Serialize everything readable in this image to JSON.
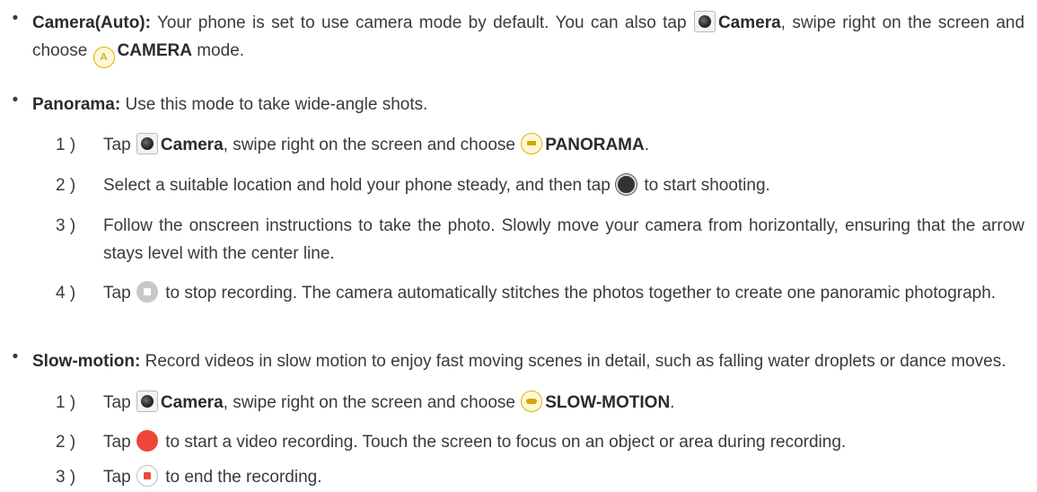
{
  "camera_auto": {
    "bullet": "•",
    "title": "Camera(Auto):",
    "text1": "Your phone is set to use camera mode by default. You can also tap",
    "camera_label": "Camera",
    "text2": ", swipe right on the screen and choose",
    "mode_icon_letter": "A",
    "mode_label": "CAMERA",
    "text3": "mode."
  },
  "panorama": {
    "bullet": "•",
    "title": "Panorama:",
    "text": "Use this mode to take wide-angle shots.",
    "steps": [
      {
        "num": "1 )",
        "a": "Tap",
        "camera_label": "Camera",
        "b": ", swipe right on the screen and choose",
        "mode_label": "PANORAMA",
        "c": "."
      },
      {
        "num": "2 )",
        "a": "Select a suitable location and hold your phone steady, and then tap",
        "b": "to start shooting."
      },
      {
        "num": "3 )",
        "text": "Follow the onscreen instructions to take the photo. Slowly move your camera from horizontally, ensuring that the arrow stays level with the center line."
      },
      {
        "num": "4 )",
        "a": "Tap",
        "b": "to stop recording. The camera automatically stitches the photos together to create one panoramic photograph."
      }
    ]
  },
  "slow_motion": {
    "bullet": "•",
    "title": "Slow-motion:",
    "text": "Record videos in slow motion to enjoy fast moving scenes in detail, such as falling water droplets or dance moves.",
    "steps": [
      {
        "num": "1 )",
        "a": "Tap",
        "camera_label": "Camera",
        "b": ", swipe right on the screen and choose",
        "mode_label": "SLOW-MOTION",
        "c": "."
      },
      {
        "num": "2 )",
        "a": "Tap",
        "b": "to start a video recording. Touch the screen to focus on an object or area during recording."
      },
      {
        "num": "3 )",
        "a": "Tap",
        "b": "to end the recording."
      }
    ]
  },
  "icons": {
    "camera_app": "camera-app-icon",
    "camera_mode": "auto-mode-icon",
    "panorama_mode": "panorama-mode-icon",
    "slow_motion_mode": "slow-motion-mode-icon",
    "shutter": "shutter-button-icon",
    "stop_gray": "stop-button-icon",
    "record_red": "record-button-icon",
    "stop_red": "stop-recording-icon"
  },
  "colors": {
    "text": "#3a3a3a",
    "record": "#f0463a",
    "mode_accent": "#e0b000"
  }
}
